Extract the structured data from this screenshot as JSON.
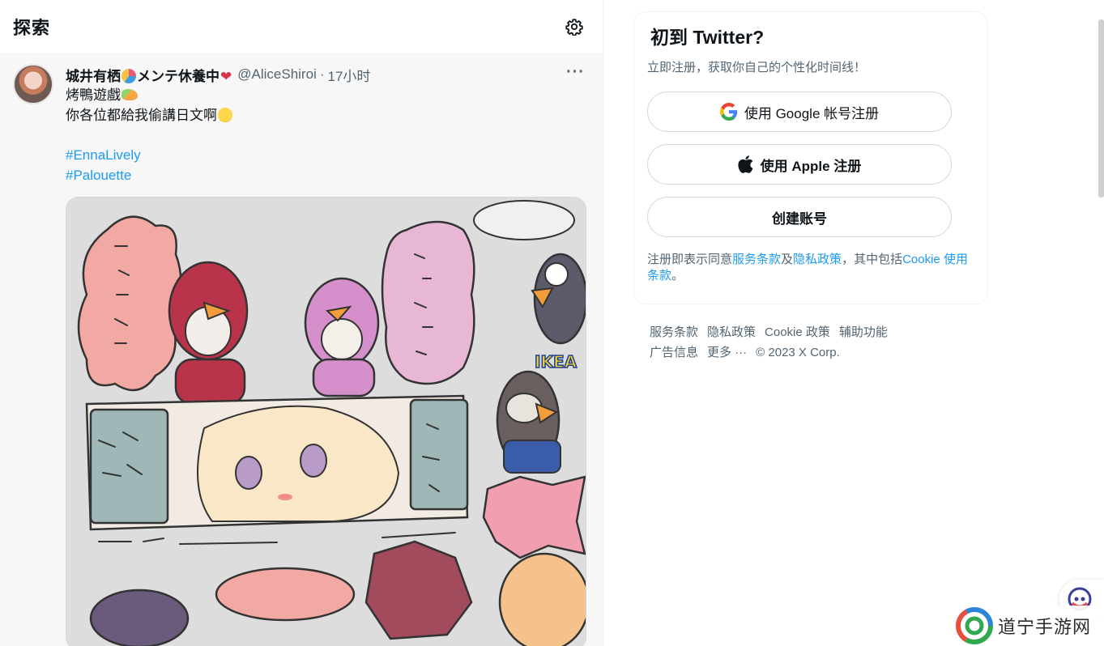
{
  "main": {
    "title": "探索",
    "settings_icon": "gear-icon"
  },
  "tweet": {
    "author_name": "城井有栖",
    "author_suffix": "メンテ休養中",
    "handle": "@AliceShiroi",
    "separator": "·",
    "time": "17小时",
    "more_icon": "more-dots-icon",
    "line1": "烤鴨遊戲",
    "line2": "你各位都給我偷講日文啊",
    "hashtags": [
      "#EnnaLively",
      "#Palouette"
    ],
    "media_alt": "comic illustration image"
  },
  "signup": {
    "title": "初到 Twitter?",
    "subtitle": "立即注册，获取你自己的个性化时间线！",
    "google_button": "使用 Google 帐号注册",
    "apple_button": "使用 Apple 注册",
    "create_button": "创建账号",
    "legal_prefix": "注册即表示同意",
    "terms_link": "服务条款",
    "legal_and": "及",
    "privacy_link": "隐私政策",
    "legal_mid": "，其中包括",
    "cookie_link": "Cookie 使用条款",
    "legal_end": "。"
  },
  "footer": {
    "links": [
      "服务条款",
      "隐私政策",
      "Cookie 政策",
      "辅助功能",
      "广告信息",
      "更多 ···"
    ],
    "copyright": "© 2023 X Corp."
  },
  "watermark": {
    "text": "道宁手游网"
  },
  "colors": {
    "accent": "#1d9bf0",
    "text_primary": "#0f1419",
    "text_secondary": "#536471",
    "border": "#cfd9de"
  }
}
